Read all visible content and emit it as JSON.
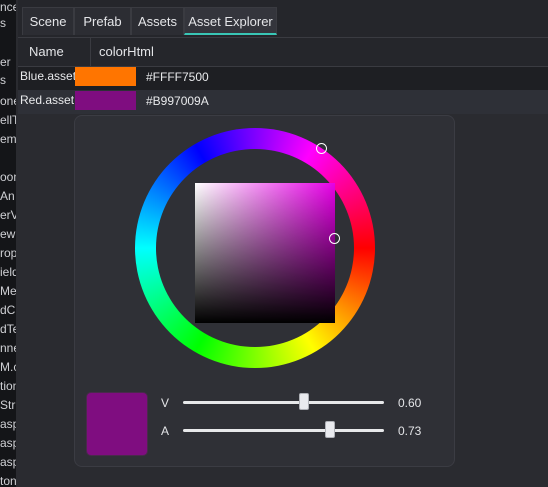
{
  "left_strip": {
    "items": [
      "nce",
      "s",
      "",
      "er",
      "s",
      "one",
      "ellT",
      "em",
      "",
      "oon",
      "An",
      "erVi",
      "ew",
      "rop",
      "ield",
      "Men",
      "dC",
      "dTe",
      "nne",
      "M.c",
      "tion",
      "Stri",
      "asp",
      "asp",
      "asp",
      "ton"
    ]
  },
  "tabs": [
    {
      "label": "Scene"
    },
    {
      "label": "Prefab"
    },
    {
      "label": "Assets"
    },
    {
      "label": "Asset Explorer",
      "active": true
    }
  ],
  "table": {
    "columns": [
      "Name",
      "colorHtml"
    ],
    "rows": [
      {
        "name": "Blue.asset",
        "swatch": "#FF7500",
        "hex": "#FFFF7500"
      },
      {
        "name": "Red.asset",
        "swatch": "#7F0D80",
        "hex": "#B997009A",
        "selected": true
      }
    ]
  },
  "color_picker": {
    "preview_color": "#7F0D80",
    "sliders": [
      {
        "label": "V",
        "value": 0.6,
        "value_text": "0.60"
      },
      {
        "label": "A",
        "value": 0.73,
        "value_text": "0.73"
      }
    ]
  },
  "colors": {
    "accent": "#39C6B6",
    "background": "#2A2B30"
  }
}
